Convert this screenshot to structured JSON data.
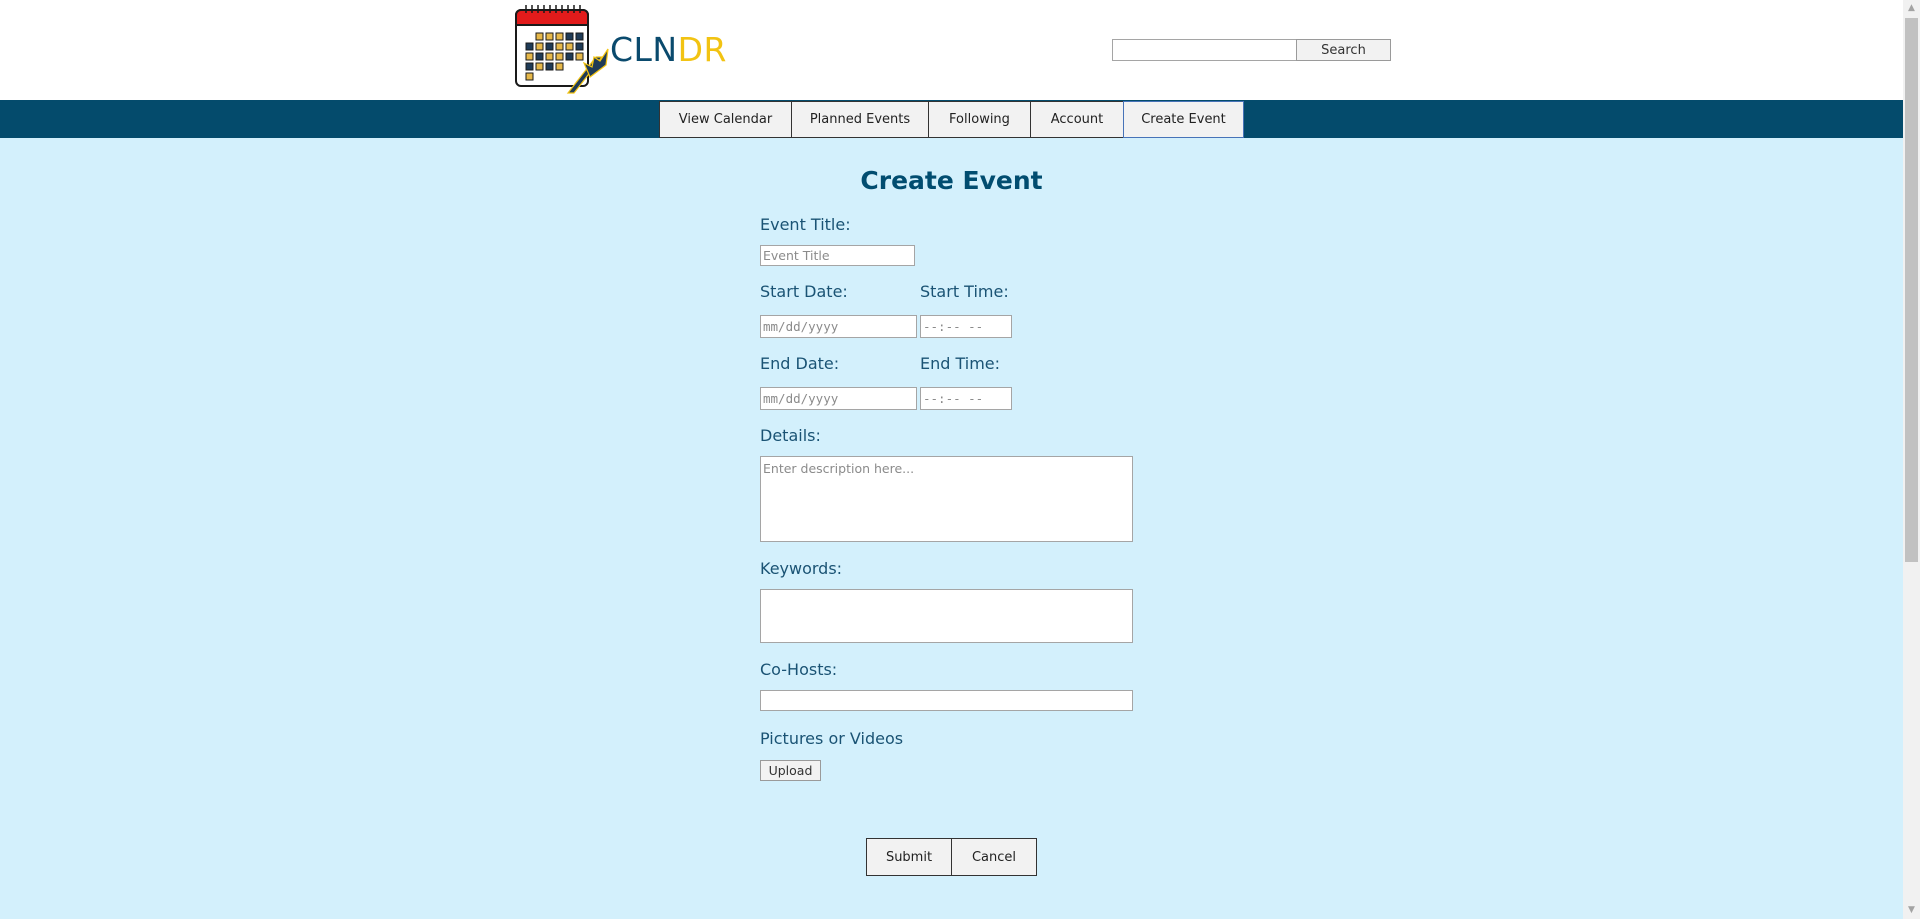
{
  "header": {
    "brand_part1": "CLN",
    "brand_part2": "DR",
    "search_button": "Search",
    "search_value": ""
  },
  "nav": {
    "items": [
      "View Calendar",
      "Planned Events",
      "Following",
      "Account",
      "Create Event"
    ],
    "active": "Create Event"
  },
  "form": {
    "title": "Create Event",
    "event_title_label": "Event Title:",
    "event_title_placeholder": "Event Title",
    "start_date_label": "Start Date:",
    "start_time_label": "Start Time:",
    "end_date_label": "End Date:",
    "end_time_label": "End Time:",
    "date_placeholder": "mm/dd/yyyy",
    "time_placeholder": "--:-- --",
    "details_label": "Details:",
    "details_placeholder": "Enter description here...",
    "keywords_label": "Keywords:",
    "cohosts_label": "Co-Hosts:",
    "media_label": "Pictures or Videos",
    "upload_button": "Upload",
    "submit_button": "Submit",
    "cancel_button": "Cancel"
  },
  "colors": {
    "page_background": "#d3f0fc",
    "navbar": "#044b6c",
    "brand_blue": "#0a4a6d",
    "brand_yellow": "#f2c312",
    "calendar_red": "#e21b1b"
  }
}
